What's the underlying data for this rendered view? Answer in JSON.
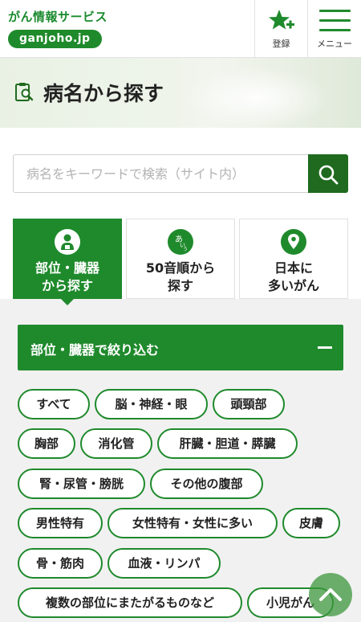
{
  "header": {
    "brand_name": "がん情報サービス",
    "brand_url": "ganjoho.jp",
    "register_label": "登録",
    "menu_label": "メニュー"
  },
  "banner": {
    "title": "病名から探す"
  },
  "search": {
    "placeholder": "病名をキーワードで検索（サイト内）"
  },
  "tabs": [
    {
      "label_line1": "部位・臓器",
      "label_line2": "から探す",
      "icon": "person-icon",
      "active": true
    },
    {
      "label_line1": "50音順から",
      "label_line2": "探す",
      "icon": "aiu-icon",
      "active": false
    },
    {
      "label_line1": "日本に",
      "label_line2": "多いがん",
      "icon": "map-pin-icon",
      "active": false
    }
  ],
  "filter": {
    "title": "部位・臓器で絞り込む",
    "chips": [
      "すべて",
      "脳・神経・眼",
      "頭頸部",
      "胸部",
      "消化管",
      "肝臓・胆道・膵臓",
      "腎・尿管・膀胱",
      "その他の腹部",
      "男性特有",
      "女性特有・女性に多い",
      "皮膚",
      "骨・筋肉",
      "血液・リンパ",
      "複数の部位にまたがるものなど",
      "小児がん"
    ]
  },
  "colors": {
    "brand_green": "#1f8a2c",
    "dark_green": "#1f6a1f"
  }
}
